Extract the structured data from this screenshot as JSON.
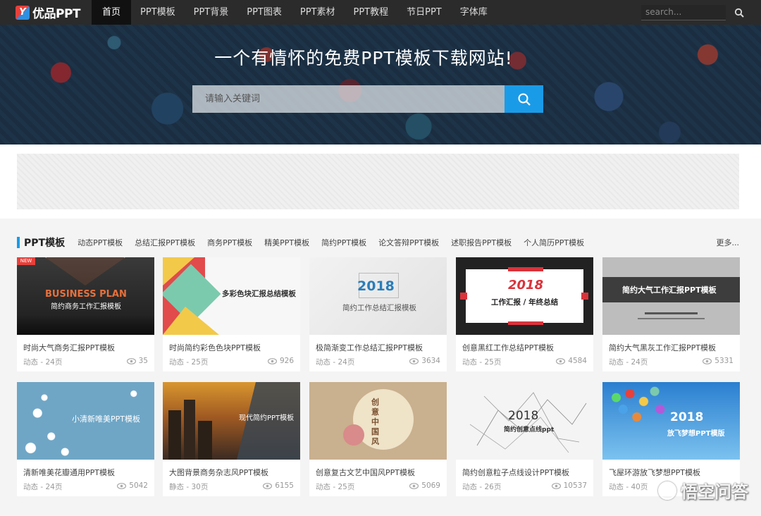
{
  "nav": {
    "logo_text": "优品PPT",
    "logo_mark": "Y",
    "items": [
      "首页",
      "PPT模板",
      "PPT背景",
      "PPT图表",
      "PPT素材",
      "PPT教程",
      "节日PPT",
      "字体库"
    ],
    "search_placeholder": "search..."
  },
  "hero": {
    "title": "一个有情怀的免费PPT模板下载网站!",
    "search_placeholder": "请输入关键词"
  },
  "category": {
    "title": "PPT模板",
    "links": [
      "动态PPT模板",
      "总结汇报PPT模板",
      "商务PPT模板",
      "精美PPT模板",
      "简约PPT模板",
      "论文答辩PPT模板",
      "述职报告PPT模板",
      "个人简历PPT模板"
    ],
    "more": "更多..."
  },
  "cards": [
    {
      "title": "时尚大气商务汇报PPT模板",
      "meta": "动态 - 24页",
      "views": "35",
      "badge": "NEW",
      "thumb_lines": [
        "BUSINESS PLAN",
        "简约商务工作汇报模板"
      ]
    },
    {
      "title": "时尚简约彩色色块PPT模板",
      "meta": "动态 - 25页",
      "views": "926",
      "thumb_lines": [
        "多彩色块汇报总结模板"
      ]
    },
    {
      "title": "极简渐变工作总结汇报PPT模板",
      "meta": "动态 - 24页",
      "views": "3634",
      "thumb_lines": [
        "2018",
        "简约工作总结汇报模板"
      ]
    },
    {
      "title": "创意黑红工作总结PPT模板",
      "meta": "动态 - 25页",
      "views": "4584",
      "thumb_lines": [
        "2018",
        "工作汇报 / 年终总结"
      ]
    },
    {
      "title": "简约大气黑灰工作汇报PPT模板",
      "meta": "动态 - 24页",
      "views": "5331",
      "thumb_lines": [
        "简约大气工作汇报PPT模板"
      ]
    },
    {
      "title": "清新唯美花瓣通用PPT模板",
      "meta": "动态 - 24页",
      "views": "5042",
      "thumb_lines": [
        "小清新唯美PPT模板"
      ]
    },
    {
      "title": "大图背景商务杂志风PPT模板",
      "meta": "静态 - 30页",
      "views": "6155",
      "thumb_lines": [
        "现代简约PPT模板"
      ]
    },
    {
      "title": "创意复古文艺中国风PPT模板",
      "meta": "动态 - 25页",
      "views": "5069",
      "thumb_lines": [
        "创意中国风"
      ]
    },
    {
      "title": "简约创意粒子点线设计PPT模板",
      "meta": "动态 - 26页",
      "views": "10537",
      "thumb_lines": [
        "2018",
        "简约创意点线ppt"
      ]
    },
    {
      "title": "飞屋环游放飞梦想PPT模板",
      "meta": "动态 - 40页",
      "views": "",
      "thumb_lines": [
        "2018",
        "放飞梦想PPT模版"
      ]
    }
  ],
  "watermark": "悟空问答",
  "colors": {
    "accent": "#1a9be8",
    "nav_bg": "#2b2b2b",
    "badge": "#e8403b"
  },
  "icons": {
    "search": "search-icon",
    "eye": "eye-icon"
  }
}
